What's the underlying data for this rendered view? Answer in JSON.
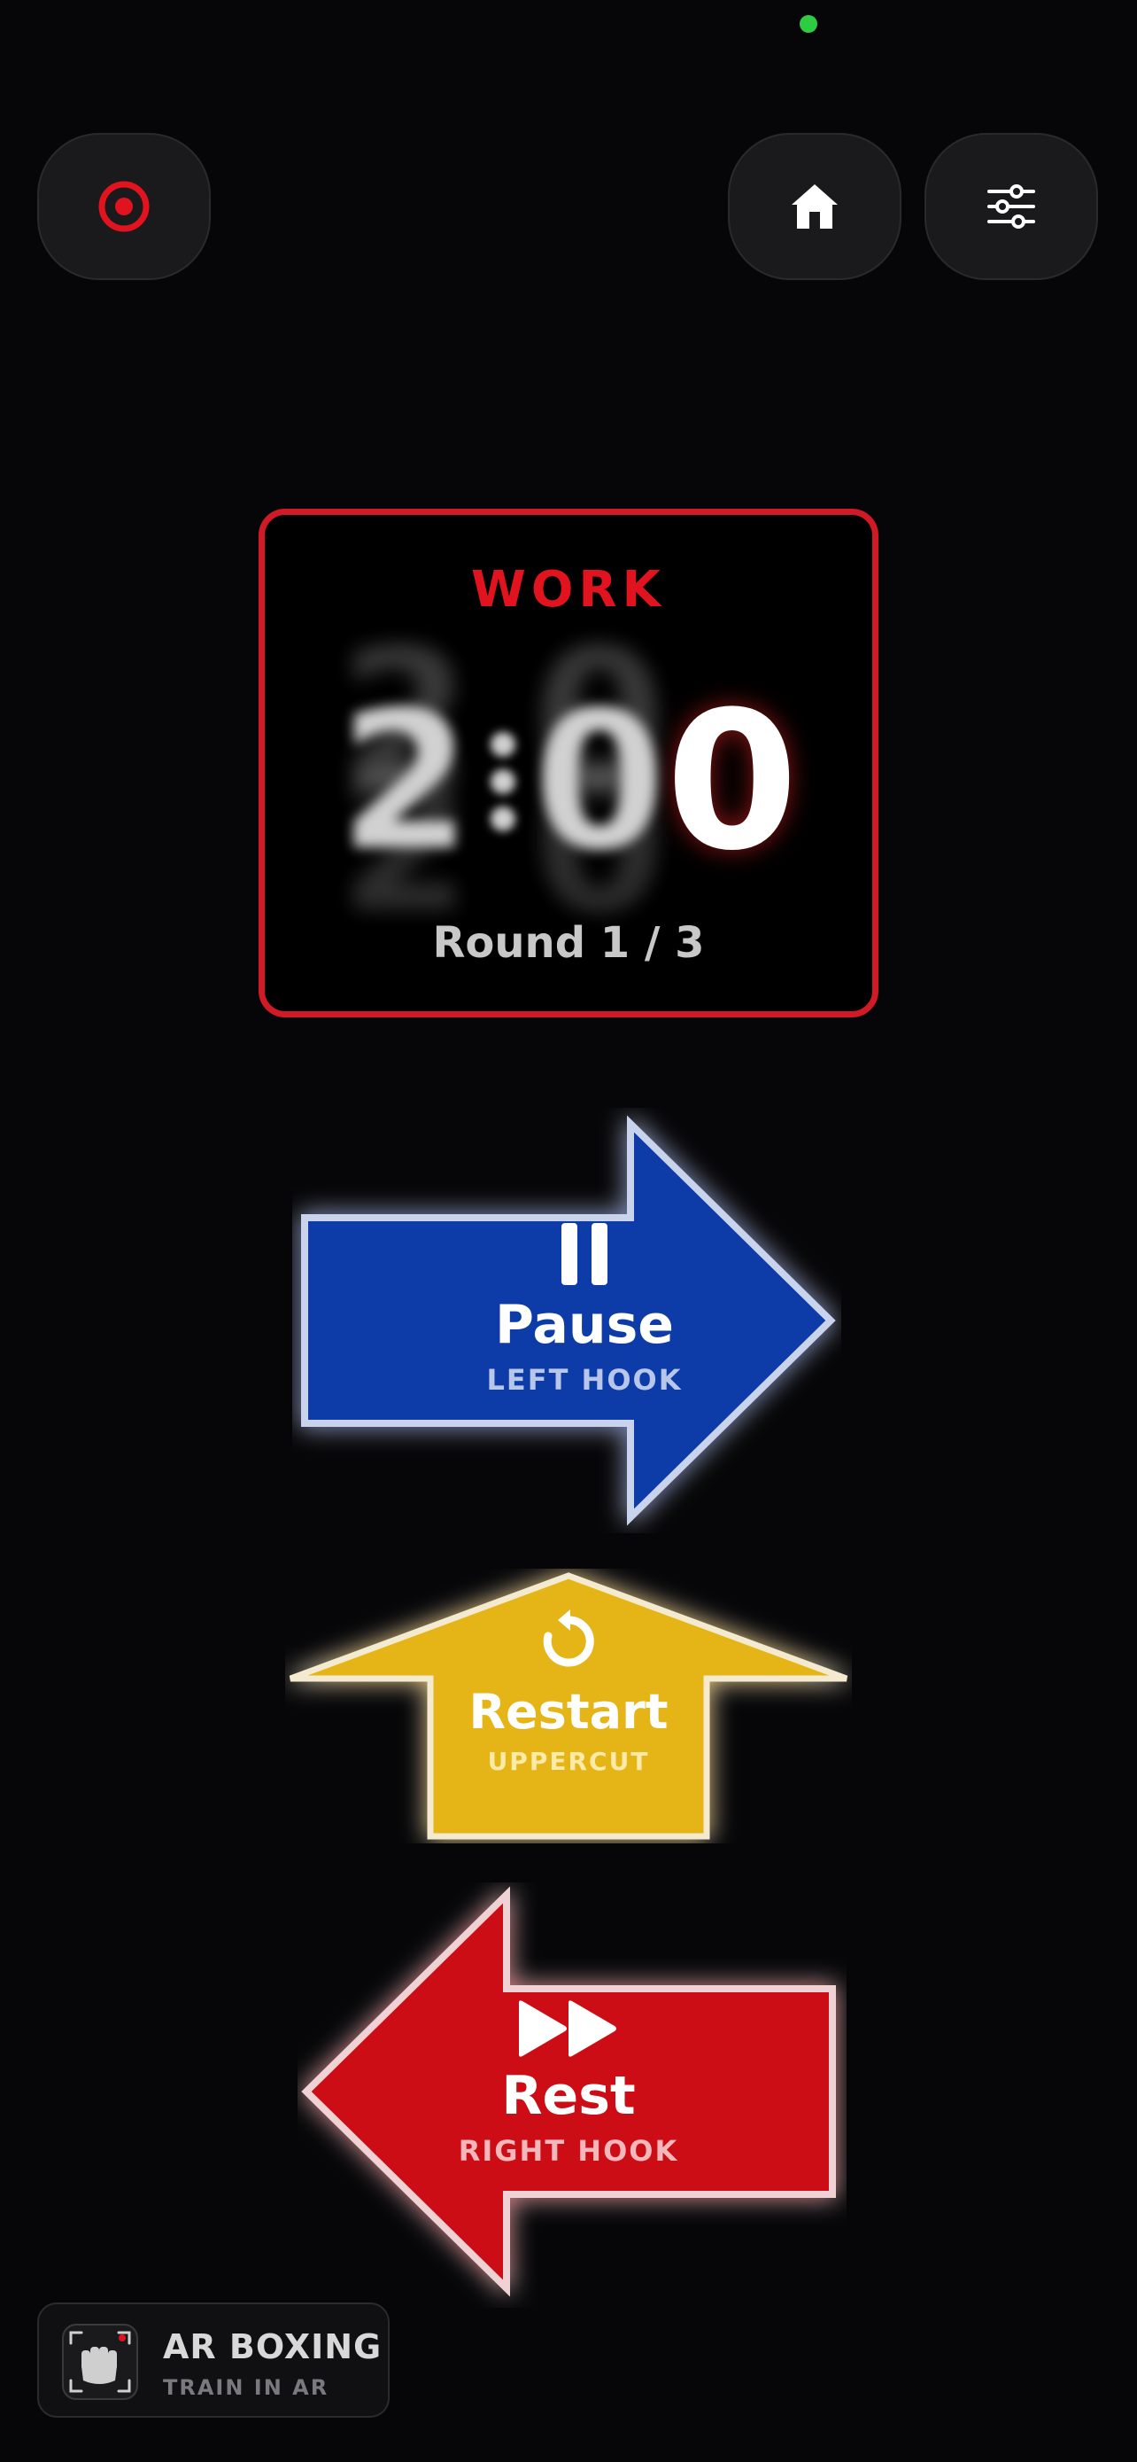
{
  "colors": {
    "background": "#060608",
    "accent_red": "#e0131e",
    "left_hook_blue": "#0a3aa8",
    "uppercut_yellow": "#e5b418",
    "right_hook_red": "#cc1018"
  },
  "top_bar": {
    "left_button_icon": "target-icon",
    "home_button_icon": "home-icon",
    "settings_button_icon": "sliders-icon"
  },
  "timer": {
    "phase": "WORK",
    "minutes": "2",
    "seconds_tens": "0",
    "seconds_ones": "0",
    "round_text": "Round 1 / 3"
  },
  "controls": {
    "pause": {
      "icon": "pause-icon",
      "label": "Pause",
      "punch": "LEFT HOOK",
      "direction": "right"
    },
    "restart": {
      "icon": "restart-icon",
      "label": "Restart",
      "punch": "UPPERCUT",
      "direction": "up"
    },
    "rest": {
      "icon": "fast-forward-icon",
      "label": "Rest",
      "punch": "RIGHT HOOK",
      "direction": "left"
    }
  },
  "badge": {
    "icon": "fist-icon",
    "title": "AR BOXING",
    "subtitle": "TRAIN IN AR"
  }
}
